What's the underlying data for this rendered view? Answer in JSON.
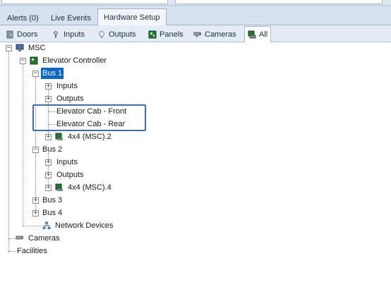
{
  "main_tabs": [
    "Alerts (0)",
    "Live Events",
    "Hardware Setup"
  ],
  "sub_tabs": [
    {
      "label": "Doors",
      "icon": "door-icon"
    },
    {
      "label": "Inputs",
      "icon": "input-icon"
    },
    {
      "label": "Outputs",
      "icon": "lightbulb-icon"
    },
    {
      "label": "Panels",
      "icon": "panel-board-icon"
    },
    {
      "label": "Cameras",
      "icon": "camera-icon"
    },
    {
      "label": "All",
      "icon": "all-devices-icon"
    }
  ],
  "tree": {
    "root": "MSC",
    "elevator_controller": "Elevator Controller",
    "bus1": "Bus 1",
    "bus1_inputs": "Inputs",
    "bus1_outputs": "Outputs",
    "cab_front": "Elevator Cab - Front",
    "cab_rear": "Elevator Cab - Rear",
    "bus1_board": "4x4 (MSC).2",
    "bus2": "Bus 2",
    "bus2_inputs": "Inputs",
    "bus2_outputs": "Outputs",
    "bus2_board": "4x4 (MSC).4",
    "bus3": "Bus 3",
    "bus4": "Bus 4",
    "network_devices": "Network Devices",
    "cameras": "Cameras",
    "facilities": "Facilities"
  },
  "colors": {
    "selection": "#0b67c9",
    "highlight_box": "#3a6fb3"
  }
}
